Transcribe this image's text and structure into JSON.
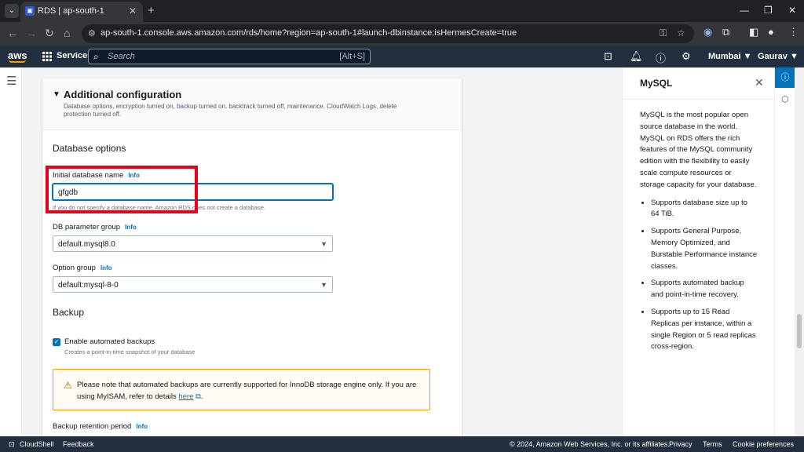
{
  "browser": {
    "tab_title": "RDS | ap-south-1",
    "url": "ap-south-1.console.aws.amazon.com/rds/home?region=ap-south-1#launch-dbinstance:isHermesCreate=true"
  },
  "aws_nav": {
    "logo": "aws",
    "services": "Services",
    "search_placeholder": "Search",
    "search_shortcut": "[Alt+S]",
    "region": "Mumbai ▼",
    "user": "Gaurav ▼"
  },
  "card": {
    "title": "Additional configuration",
    "description": "Database options, encryption turned on, backup turned on, backtrack turned off, maintenance, CloudWatch Logs, delete protection turned off.",
    "database_options_title": "Database options",
    "initial_db": {
      "label": "Initial database name",
      "info": "Info",
      "value": "gfgdb",
      "hint": "If you do not specify a database name, Amazon RDS does not create a database."
    },
    "param_group": {
      "label": "DB parameter group",
      "info": "Info",
      "value": "default.mysql8.0"
    },
    "option_group": {
      "label": "Option group",
      "info": "Info",
      "value": "default:mysql-8-0"
    },
    "backup_title": "Backup",
    "backup_checkbox": {
      "label": "Enable automated backups",
      "hint": "Creates a point-in-time snapshot of your database",
      "checked": true
    },
    "alert": {
      "text": "Please note that automated backups are currently supported for InnoDB storage engine only. If you are using MyISAM, refer to details ",
      "link": "here",
      "end": "."
    },
    "retention": {
      "label": "Backup retention period",
      "info": "Info"
    }
  },
  "help_panel": {
    "title": "MySQL",
    "intro": "MySQL is the most popular open source database in the world. MySQL on RDS offers the rich features of the MySQL community edition with the flexibility to easily scale compute resources or storage capacity for your database.",
    "bullets": [
      "Supports database size up to 64 TiB.",
      "Supports General Purpose, Memory Optimized, and Burstable Performance instance classes.",
      "Supports automated backup and point-in-time recovery.",
      "Supports up to 15 Read Replicas per instance, within a single Region or 5 read replicas cross-region."
    ]
  },
  "footer": {
    "cloudshell": "CloudShell",
    "feedback": "Feedback",
    "copyright": "© 2024, Amazon Web Services, Inc. or its affiliates.",
    "privacy": "Privacy",
    "terms": "Terms",
    "cookies": "Cookie preferences"
  }
}
